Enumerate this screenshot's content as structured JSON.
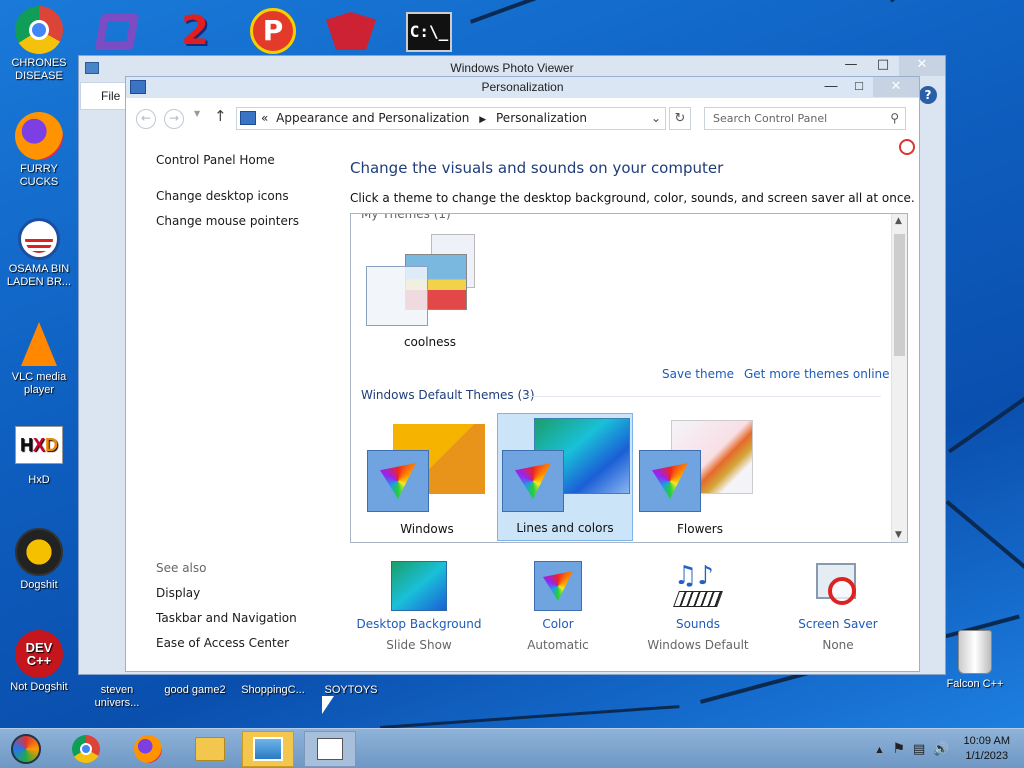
{
  "desktop": {
    "icons_left": [
      {
        "label": "CHRONES\nDISEASE",
        "icon": "chrome-icon"
      },
      {
        "label": "FURRY CUCKS",
        "icon": "firefox-icon"
      },
      {
        "label": "OSAMA BIN\nLADEN BR...",
        "icon": "obama-logo-icon"
      },
      {
        "label": "VLC media\nplayer",
        "icon": "vlc-icon"
      },
      {
        "label": "HxD",
        "icon": "hxd-icon"
      },
      {
        "label": "Dogshit",
        "icon": "code-blocks-icon"
      },
      {
        "label": "Not Dogshit",
        "icon": "devcpp-icon"
      }
    ],
    "icons_top": [
      {
        "icon": "visual-studio-icon"
      },
      {
        "icon": "two-icon"
      },
      {
        "icon": "p-icon"
      },
      {
        "icon": "patriot-icon"
      },
      {
        "icon": "cmd-icon"
      }
    ],
    "icons_bottom": [
      {
        "label": "steven\nunivers..."
      },
      {
        "label": "good game2"
      },
      {
        "label": "ShoppingC..."
      },
      {
        "label": "SOYTOYS"
      }
    ],
    "recycle_bin": {
      "label": "Falcon C++"
    }
  },
  "photo_viewer": {
    "title": "Windows Photo Viewer",
    "menu_file": "File"
  },
  "window": {
    "title": "Personalization",
    "address": {
      "separator": "«",
      "crumbs": [
        "Appearance and Personalization",
        "Personalization"
      ]
    },
    "search_placeholder": "Search Control Panel",
    "left_nav": {
      "home": "Control Panel Home",
      "links": [
        "Change desktop icons",
        "Change mouse pointers"
      ]
    },
    "heading": "Change the visuals and sounds on your computer",
    "subheading": "Click a theme to change the desktop background, color, sounds, and screen saver all at once.",
    "my_themes_label": "My Themes (1)",
    "my_themes": [
      {
        "name": "coolness"
      }
    ],
    "save_theme": "Save theme",
    "get_more": "Get more themes online",
    "default_label": "Windows Default Themes (3)",
    "default_themes": [
      {
        "name": "Windows",
        "selected": false
      },
      {
        "name": "Lines and colors",
        "selected": true
      },
      {
        "name": "Flowers",
        "selected": false
      }
    ],
    "see_also": {
      "label": "See also",
      "links": [
        "Display",
        "Taskbar and Navigation",
        "Ease of Access Center"
      ]
    },
    "settings": [
      {
        "title": "Desktop Background",
        "value": "Slide Show",
        "icon": "desktop-background-icon"
      },
      {
        "title": "Color",
        "value": "Automatic",
        "icon": "color-palette-icon"
      },
      {
        "title": "Sounds",
        "value": "Windows Default",
        "icon": "sounds-icon"
      },
      {
        "title": "Screen Saver",
        "value": "None",
        "icon": "screen-saver-icon"
      }
    ]
  },
  "taskbar": {
    "time": "10:09 AM",
    "date": "1/1/2023"
  },
  "colors": {
    "link": "#1e5bb8",
    "heading": "#1e3d7a",
    "selected_tile": "#cce4f7"
  }
}
